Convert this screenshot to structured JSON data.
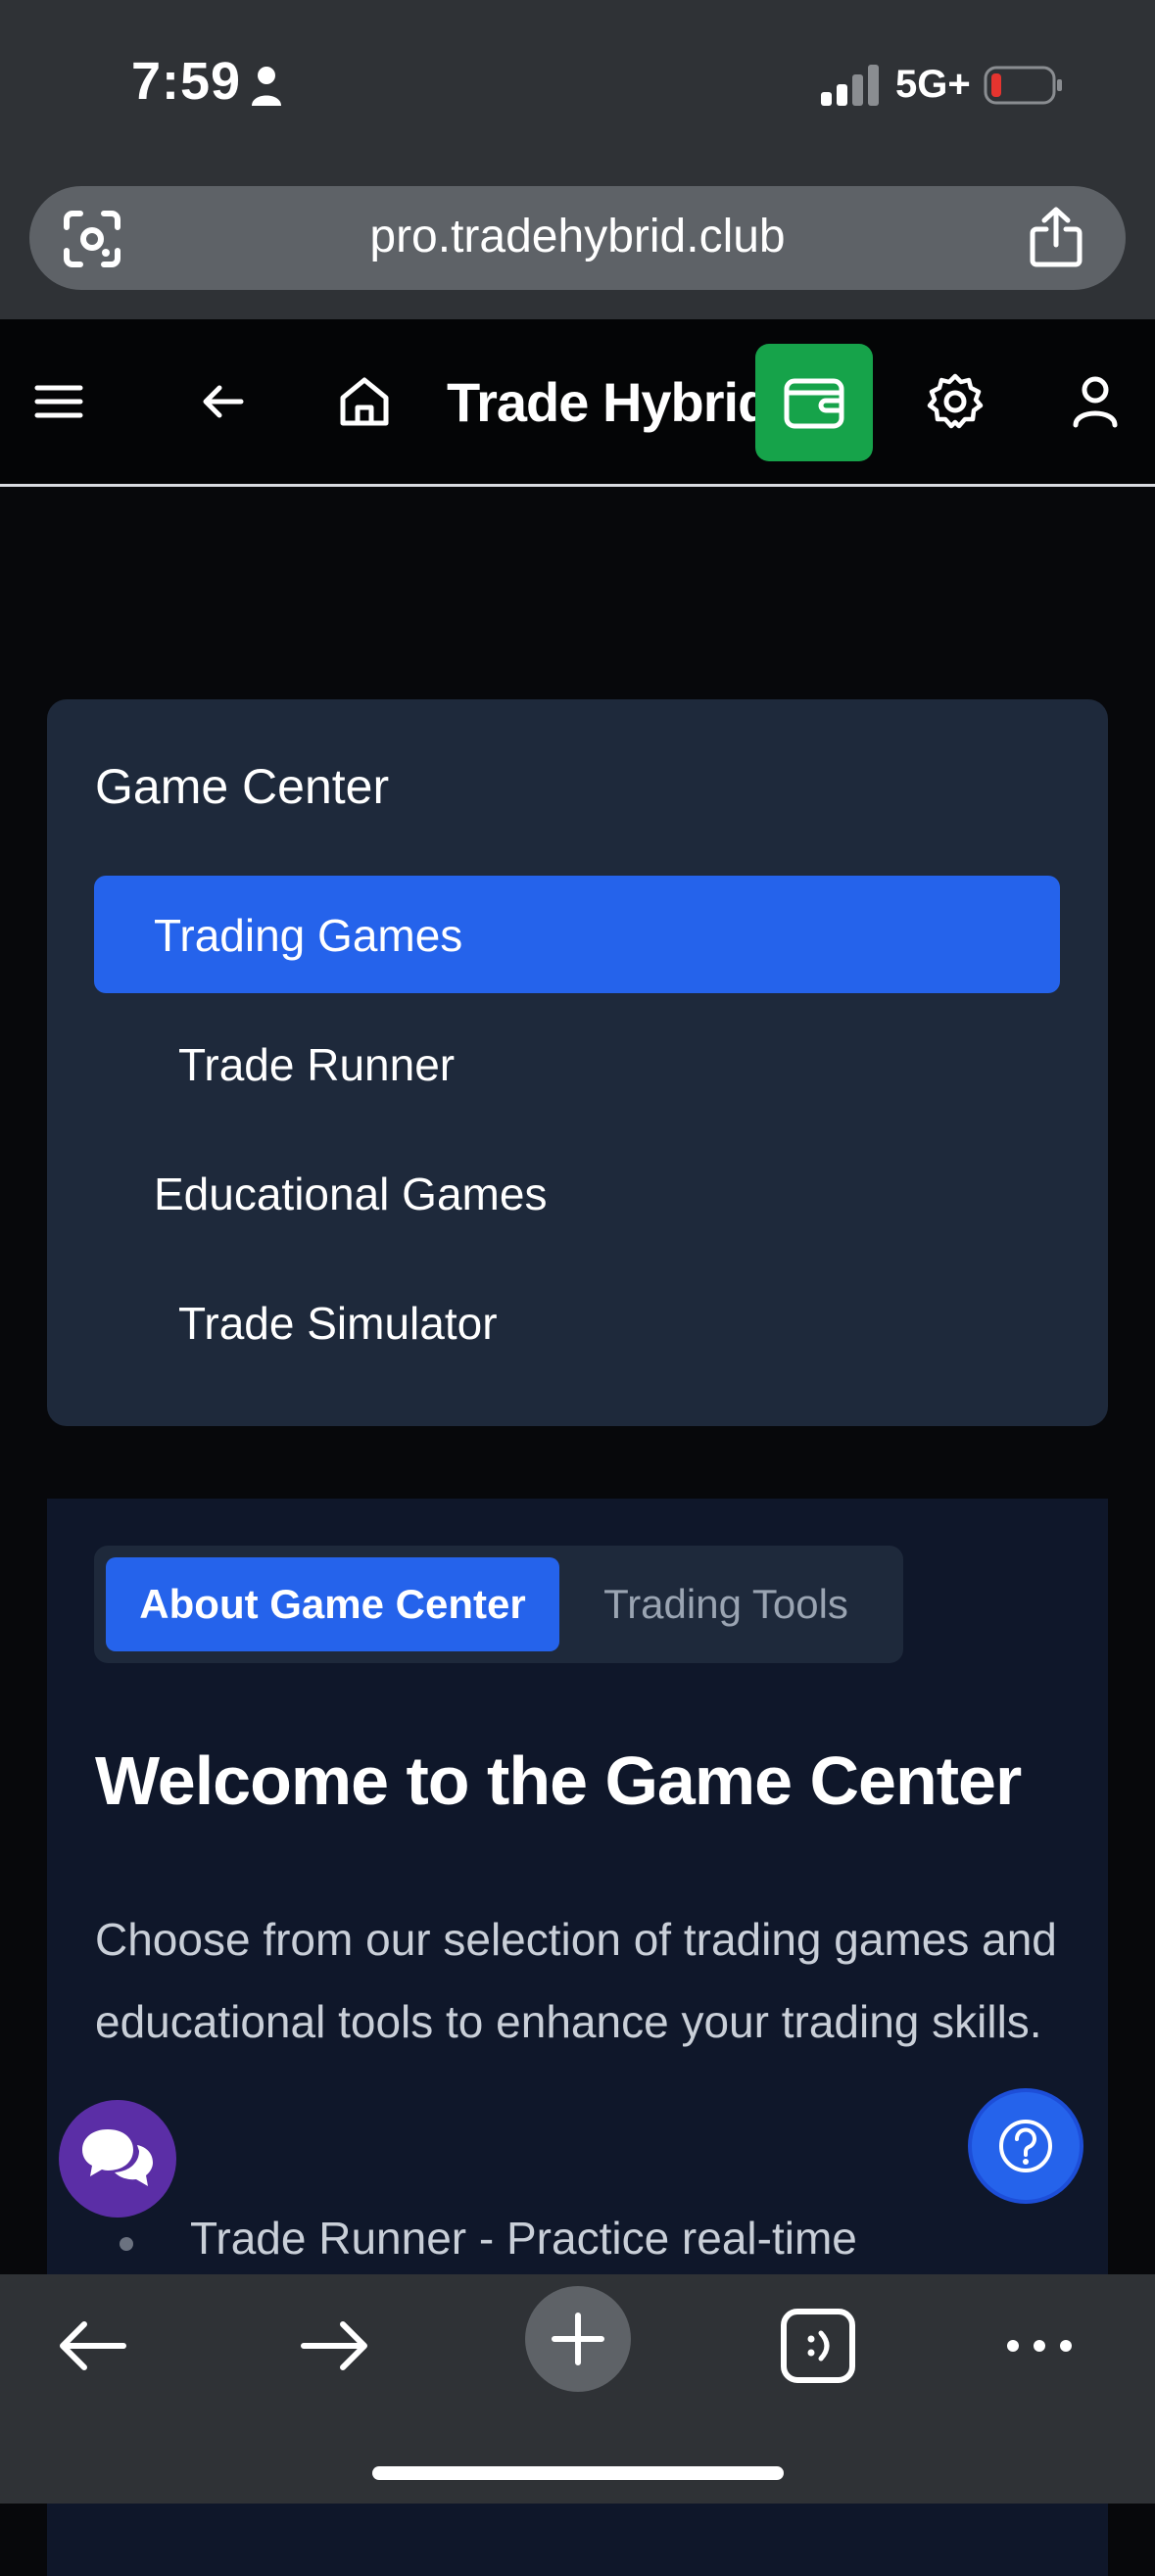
{
  "status": {
    "time": "7:59",
    "network": "5G+",
    "battery_color": "#e5342f"
  },
  "browser": {
    "url": "pro.tradehybrid.club"
  },
  "header": {
    "title": "Trade Hybrid",
    "wallet_color": "#16a34a"
  },
  "game_center": {
    "title": "Game Center",
    "items": [
      {
        "label": "Trading Games",
        "active": true
      },
      {
        "label": "Trade Runner"
      },
      {
        "label": "Educational Games"
      },
      {
        "label": "Trade Simulator"
      }
    ]
  },
  "about": {
    "tabs": [
      {
        "label": "About Game Center",
        "active": true
      },
      {
        "label": "Trading Tools"
      }
    ],
    "heading": "Welcome to the Game Center",
    "paragraph": "Choose from our selection of trading games and educational tools to enhance your trading skills.",
    "bullets": [
      "Trade Runner - Practice real-time"
    ]
  },
  "colors": {
    "accent": "#2563eb",
    "card": "#1e293b",
    "chat": "#5b2ea6"
  }
}
